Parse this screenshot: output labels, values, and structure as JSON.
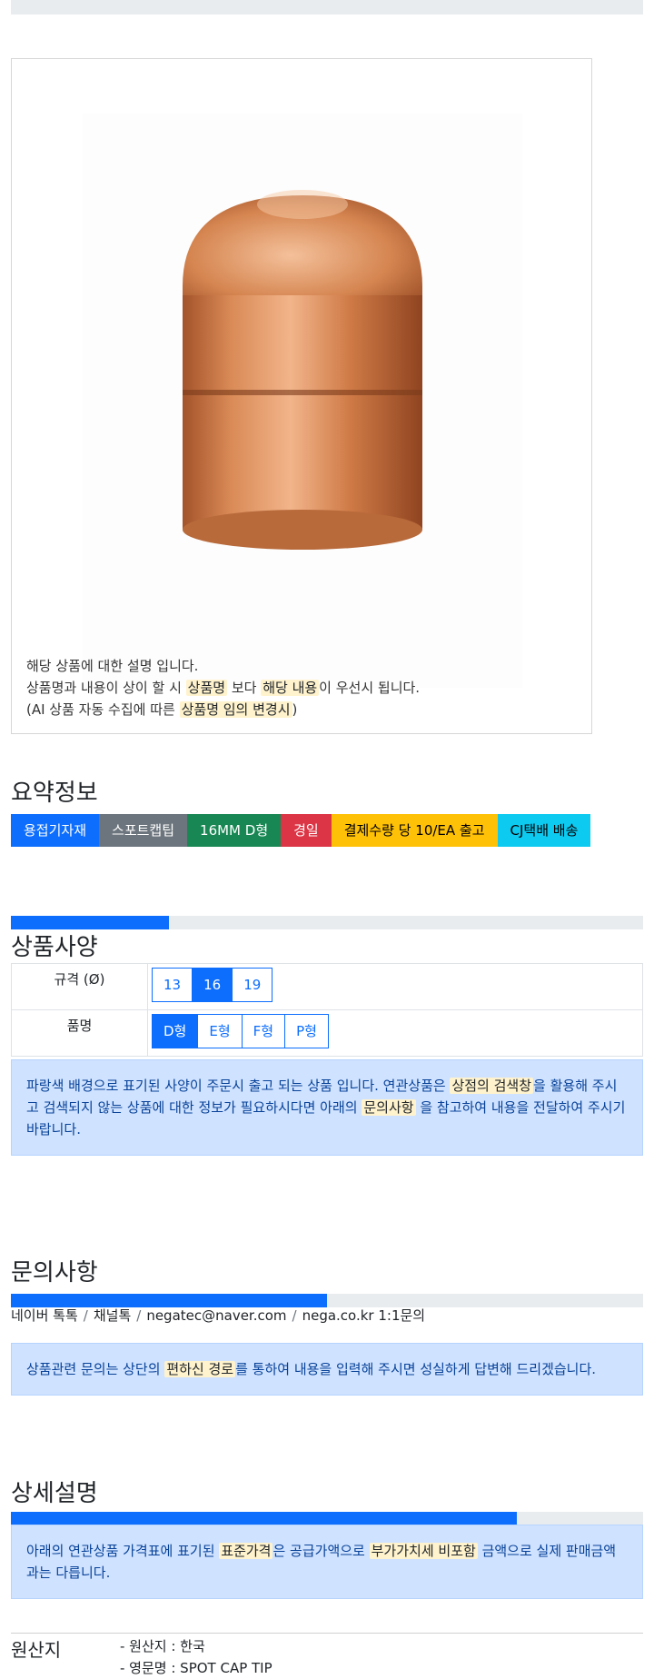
{
  "product_description": {
    "line1": "해당 상품에 대한 설명 입니다.",
    "line2_a": "상품명과 내용이 상이 할 시 ",
    "line2_mark1": "상품명",
    "line2_b": " 보다 ",
    "line2_mark2": "해당 내용",
    "line2_c": "이 우선시 됩니다.",
    "line3_a": "(AI 상품 자동 수집에 따른 ",
    "line3_mark": "상품명 임의 변경시",
    "line3_b": ")"
  },
  "summary": {
    "title": "요약정보",
    "badges": [
      {
        "label": "용접기자재",
        "color": "#0d6efd",
        "text_color": "#ffffff"
      },
      {
        "label": "스포트캡팁",
        "color": "#6c757d",
        "text_color": "#ffffff"
      },
      {
        "label": "16MM D형",
        "color": "#198754",
        "text_color": "#ffffff"
      },
      {
        "label": "경일",
        "color": "#dc3545",
        "text_color": "#ffffff"
      },
      {
        "label": "결제수량 당 10/EA 출고",
        "color": "#ffc107",
        "text_color": "#000000"
      },
      {
        "label": "CJ택배 배송",
        "color": "#0dcaf0",
        "text_color": "#000000"
      }
    ]
  },
  "spec": {
    "progress": 0.25,
    "title": "상품사양",
    "rows": [
      {
        "label": "규격 (Ø)",
        "options": [
          "13",
          "16",
          "19"
        ],
        "selected": "16"
      },
      {
        "label": "품명",
        "options": [
          "D형",
          "E형",
          "F형",
          "P형"
        ],
        "selected": "D형"
      }
    ],
    "notice_a": "파랑색 배경으로 표기된 사양이 주문시 출고 되는 상품 입니다. 연관상품은 ",
    "notice_mark1": "상점의 검색창",
    "notice_b": "을 활용해 주시고 검색되지 않는 상품에 대한 정보가 필요하시다면 아래의 ",
    "notice_mark2": "문의사항",
    "notice_c": " 을 참고하여 내용을 전달하여 주시기 바랍니다."
  },
  "inquiry": {
    "title": "문의사항",
    "progress": 0.5,
    "contacts": [
      "네이버 톡톡",
      "채널톡",
      "negatec@naver.com",
      "nega.co.kr 1:1문의"
    ],
    "notice_a": "상품관련 문의는 상단의 ",
    "notice_mark": "편하신 경로",
    "notice_b": "를 통하여 내용을 입력해 주시면 성실하게 답변해 드리겠습니다."
  },
  "detail": {
    "title": "상세설명",
    "progress": 0.8,
    "notice_a": "아래의 연관상품 가격표에 표기된 ",
    "notice_mark1": "표준가격",
    "notice_b": "은 공급가액으로 ",
    "notice_mark2": "부가가치세 비포함",
    "notice_c": " 금액으로 실제 판매금액과는 다릅니다."
  },
  "origin": {
    "label": "원산지",
    "items": [
      "- 원산지 : 한국",
      "- 영문명 : SPOT CAP TIP"
    ]
  }
}
